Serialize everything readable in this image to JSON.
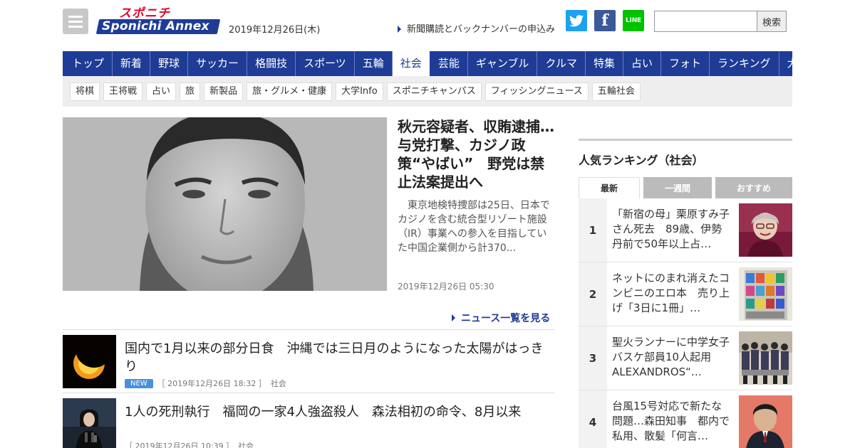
{
  "header": {
    "logo_top": "スポニチ",
    "logo_bottom": "Sponichi Annex",
    "date": "2019年12月26日(木)",
    "subscribe_link": "新聞購読とバックナンバーの申込み",
    "search_placeholder": "",
    "search_button": "検索",
    "sns": {
      "twitter": "t",
      "facebook": "f",
      "line": "LINE"
    }
  },
  "global_nav": [
    {
      "label": "トップ"
    },
    {
      "label": "新着"
    },
    {
      "label": "野球"
    },
    {
      "label": "サッカー"
    },
    {
      "label": "格闘技"
    },
    {
      "label": "スポーツ"
    },
    {
      "label": "五輪"
    },
    {
      "label": "社会",
      "active": true
    },
    {
      "label": "芸能"
    },
    {
      "label": "ギャンブル"
    },
    {
      "label": "クルマ"
    },
    {
      "label": "特集"
    },
    {
      "label": "占い"
    },
    {
      "label": "フォト"
    },
    {
      "label": "ランキング"
    },
    {
      "label": "大阪"
    }
  ],
  "sub_nav": [
    "将棋",
    "王将戦",
    "占い",
    "旅",
    "新製品",
    "旅・グルメ・健康",
    "大学Info",
    "スポニチキャンパス",
    "フィッシングニュース",
    "五輪社会"
  ],
  "hero": {
    "title": "秋元容疑者、収賄逮捕…与党打撃、カジノ政策“やばい”　野党は禁止法案提出へ",
    "summary": "東京地検特捜部は25日、日本でカジノを含む統合型リゾート施設（IR）事業への参入を目指していた中国企業側から計370...",
    "time": "2019年12月26日 05:30"
  },
  "more_link": "ニュース一覧を見る",
  "news_list": [
    {
      "title": "国内で1月以来の部分日食　沖縄では三日月のようになった太陽がはっきり",
      "badge": "NEW",
      "time": "［ 2019年12月26日 18:32 ］",
      "category": "社会"
    },
    {
      "title": "1人の死刑執行　福岡の一家4人強盗殺人　森法相初の命令、8月以来",
      "badge": "",
      "time": "［ 2019年12月26日 10:39 ］",
      "category": "社会"
    }
  ],
  "ranking": {
    "heading": "人気ランキング（社会）",
    "tabs": [
      "最新",
      "一週間",
      "おすすめ"
    ],
    "items": [
      {
        "rank": "1",
        "text": "「新宿の母」栗原すみ子さん死去　89歳、伊勢丹前で50年以上占…"
      },
      {
        "rank": "2",
        "text": "ネットにのまれ消えたコンビニのエロ本　売り上げ「3日に1冊」…"
      },
      {
        "rank": "3",
        "text": "聖火ランナーに中学女子バスケ部員10人起用　ALEXANDROS“…"
      },
      {
        "rank": "4",
        "text": "台風15号対応で新たな問題…森田知事　都内で私用、散髪「何言…"
      }
    ]
  },
  "colors": {
    "brand_blue": "#1e3c96",
    "brand_red": "#e4002b",
    "new_badge": "#4a90d9"
  }
}
